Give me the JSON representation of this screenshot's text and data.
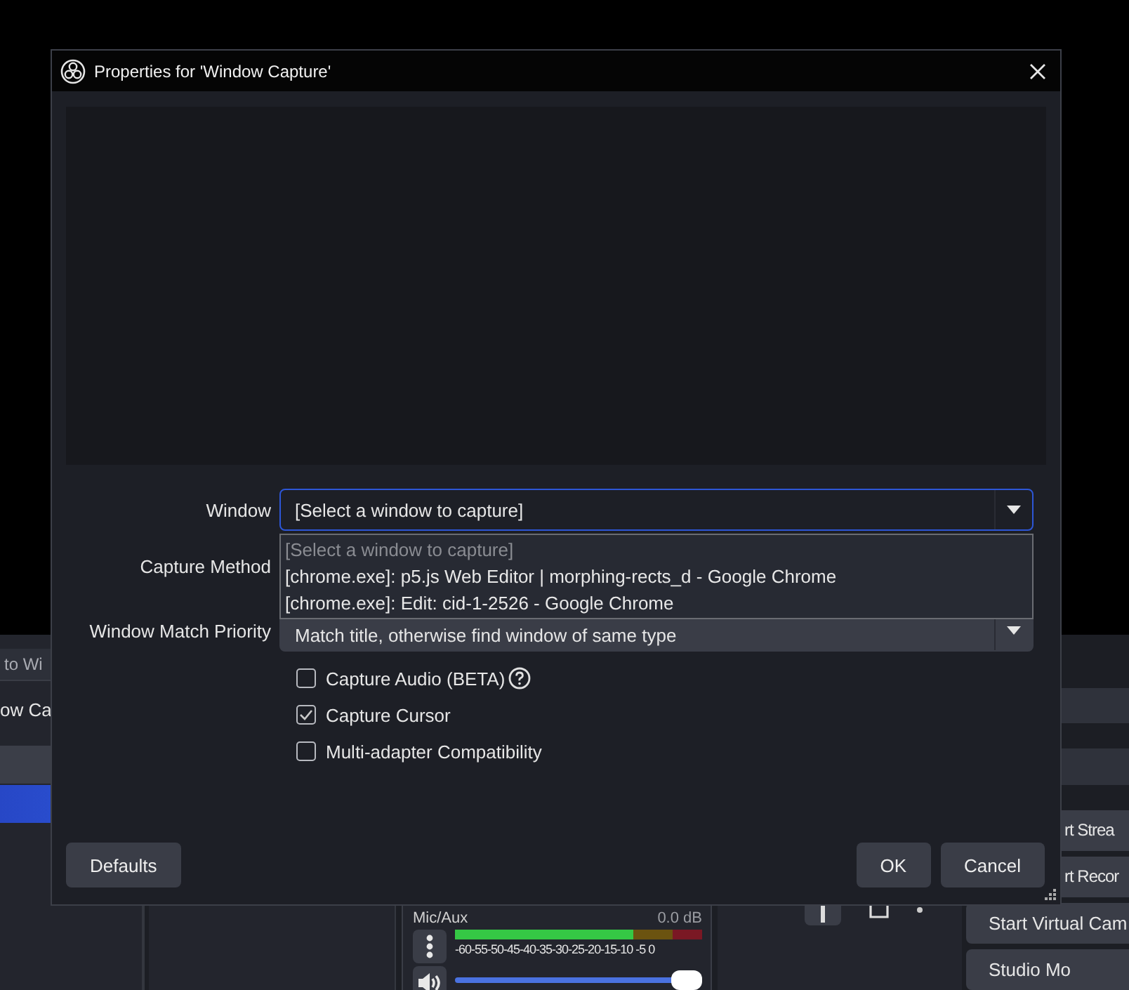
{
  "left_dock": {
    "tab": "to Wi",
    "items": [
      {
        "label": "ow Ca",
        "selected": false
      },
      {
        "selected": false
      },
      {
        "selected": true
      }
    ]
  },
  "mixer": {
    "channel": "Mic/Aux",
    "reading": "0.0 dB",
    "scale": "-60-55-50-45-40-35-30-25-20-15-10 -5 0",
    "level": 0.72,
    "volume": {
      "level": 1
    }
  },
  "controls": [
    "rt Strea",
    "rt Recor",
    "Start Virtual Cam",
    "Studio Mo"
  ],
  "dialog": {
    "title": "Properties for 'Window Capture'",
    "fields": [
      {
        "label": "Window",
        "value": "[Select a window to capture]",
        "kind": "open"
      },
      {
        "label": "Capture Method",
        "kind": "closed"
      },
      {
        "label": "Window Match Priority",
        "value": "Match title, otherwise find window of same type",
        "kind": "closed"
      }
    ],
    "dropdown": [
      {
        "label": "[Select a window to capture]",
        "disabled": true
      },
      {
        "label": "[chrome.exe]: p5.js Web Editor | morphing-rects_d - Google Chrome",
        "disabled": false
      },
      {
        "label": "[chrome.exe]: Edit: cid-1-2526 - Google Chrome",
        "disabled": false
      }
    ],
    "checkboxes": [
      {
        "label": "Capture Audio (BETA)",
        "checked": false,
        "help": true
      },
      {
        "label": "Capture Cursor",
        "checked": true,
        "help": false
      },
      {
        "label": "Multi-adapter Compatibility",
        "checked": false,
        "help": false
      }
    ],
    "defaults_button": "Defaults",
    "buttons": [
      "OK",
      "Cancel"
    ]
  }
}
